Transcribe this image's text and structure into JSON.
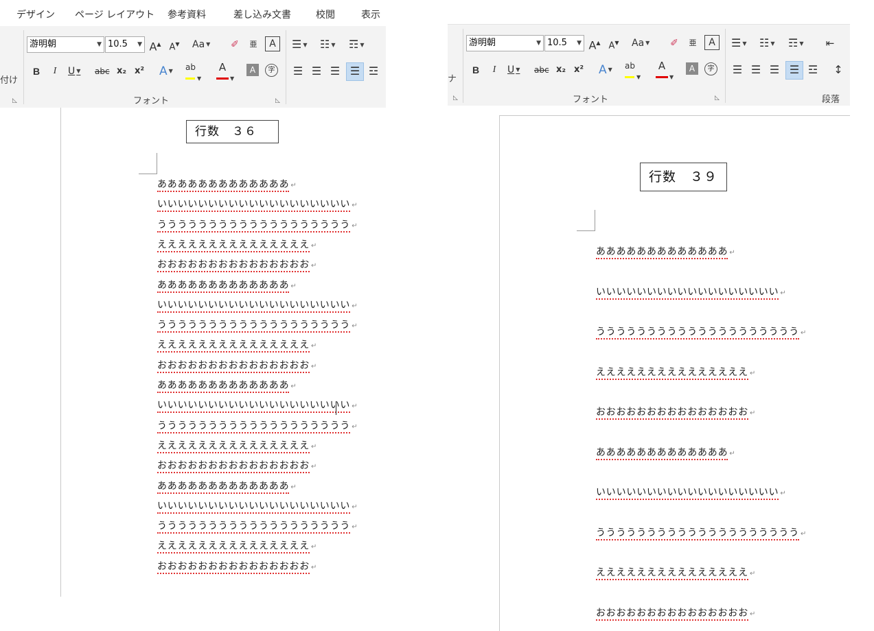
{
  "left": {
    "tabs": [
      "デザイン",
      "ページ レイアウト",
      "参考資料",
      "差し込み文書",
      "校閲",
      "表示"
    ],
    "font_name": "游明朝",
    "font_size": "10.5",
    "side_label": "付け",
    "font_group_label": "フォント",
    "line_count_label": "行数　３６",
    "lines": [
      "あああああああああああああ",
      "いいいいいいいいいいいいいいいいいいい",
      "ううううううううううううううううううう",
      "えええええええええええええええ",
      "おおおおおおおおおおおおおおお",
      "あああああああああああああ",
      "いいいいいいいいいいいいいいいいいいい",
      "ううううううううううううううううううう",
      "えええええええええええええええ",
      "おおおおおおおおおおおおおおお",
      "あああああああああああああ",
      "いいいいいいいいいいいいいいいいいいい",
      "ううううううううううううううううううう",
      "えええええええええええええええ",
      "おおおおおおおおおおおおおおお",
      "あああああああああああああ",
      "いいいいいいいいいいいいいいいいいいい",
      "ううううううううううううううううううう",
      "えええええええええええええええ",
      "おおおおおおおおおおおおおおお"
    ]
  },
  "right": {
    "font_name": "游明朝",
    "font_size": "10.5",
    "side_label": "ナ",
    "font_group_label": "フォント",
    "paragraph_group_label": "段落",
    "line_count_label": "行数　３９",
    "lines": [
      "あああああああああああああ",
      "いいいいいいいいいいいいいいいいいい",
      "うううううううううううううううううううう",
      "えええええええええええええええ",
      "おおおおおおおおおおおおおおお",
      "あああああああああああああ",
      "いいいいいいいいいいいいいいいいいい",
      "うううううううううううううううううううう",
      "えええええええええええええええ",
      "おおおおおおおおおおおおおおお"
    ]
  },
  "ribbon_labels": {
    "grow": "A",
    "shrink": "A",
    "case": "Aa",
    "bold": "B",
    "italic": "I",
    "underline": "U",
    "strike": "abc",
    "subscript": "x₂",
    "superscript": "x²",
    "text_effect": "A",
    "highlight": "ab",
    "font_color": "A",
    "shading": "A",
    "enclose": "字",
    "phonetic": "亜",
    "border_char": "A"
  },
  "paragraph_mark": "↵",
  "colors": {
    "highlight": "#ffff00",
    "font_color": "#e00000",
    "spell_underline": "#e03030",
    "active_button": "#c5dcf3"
  }
}
